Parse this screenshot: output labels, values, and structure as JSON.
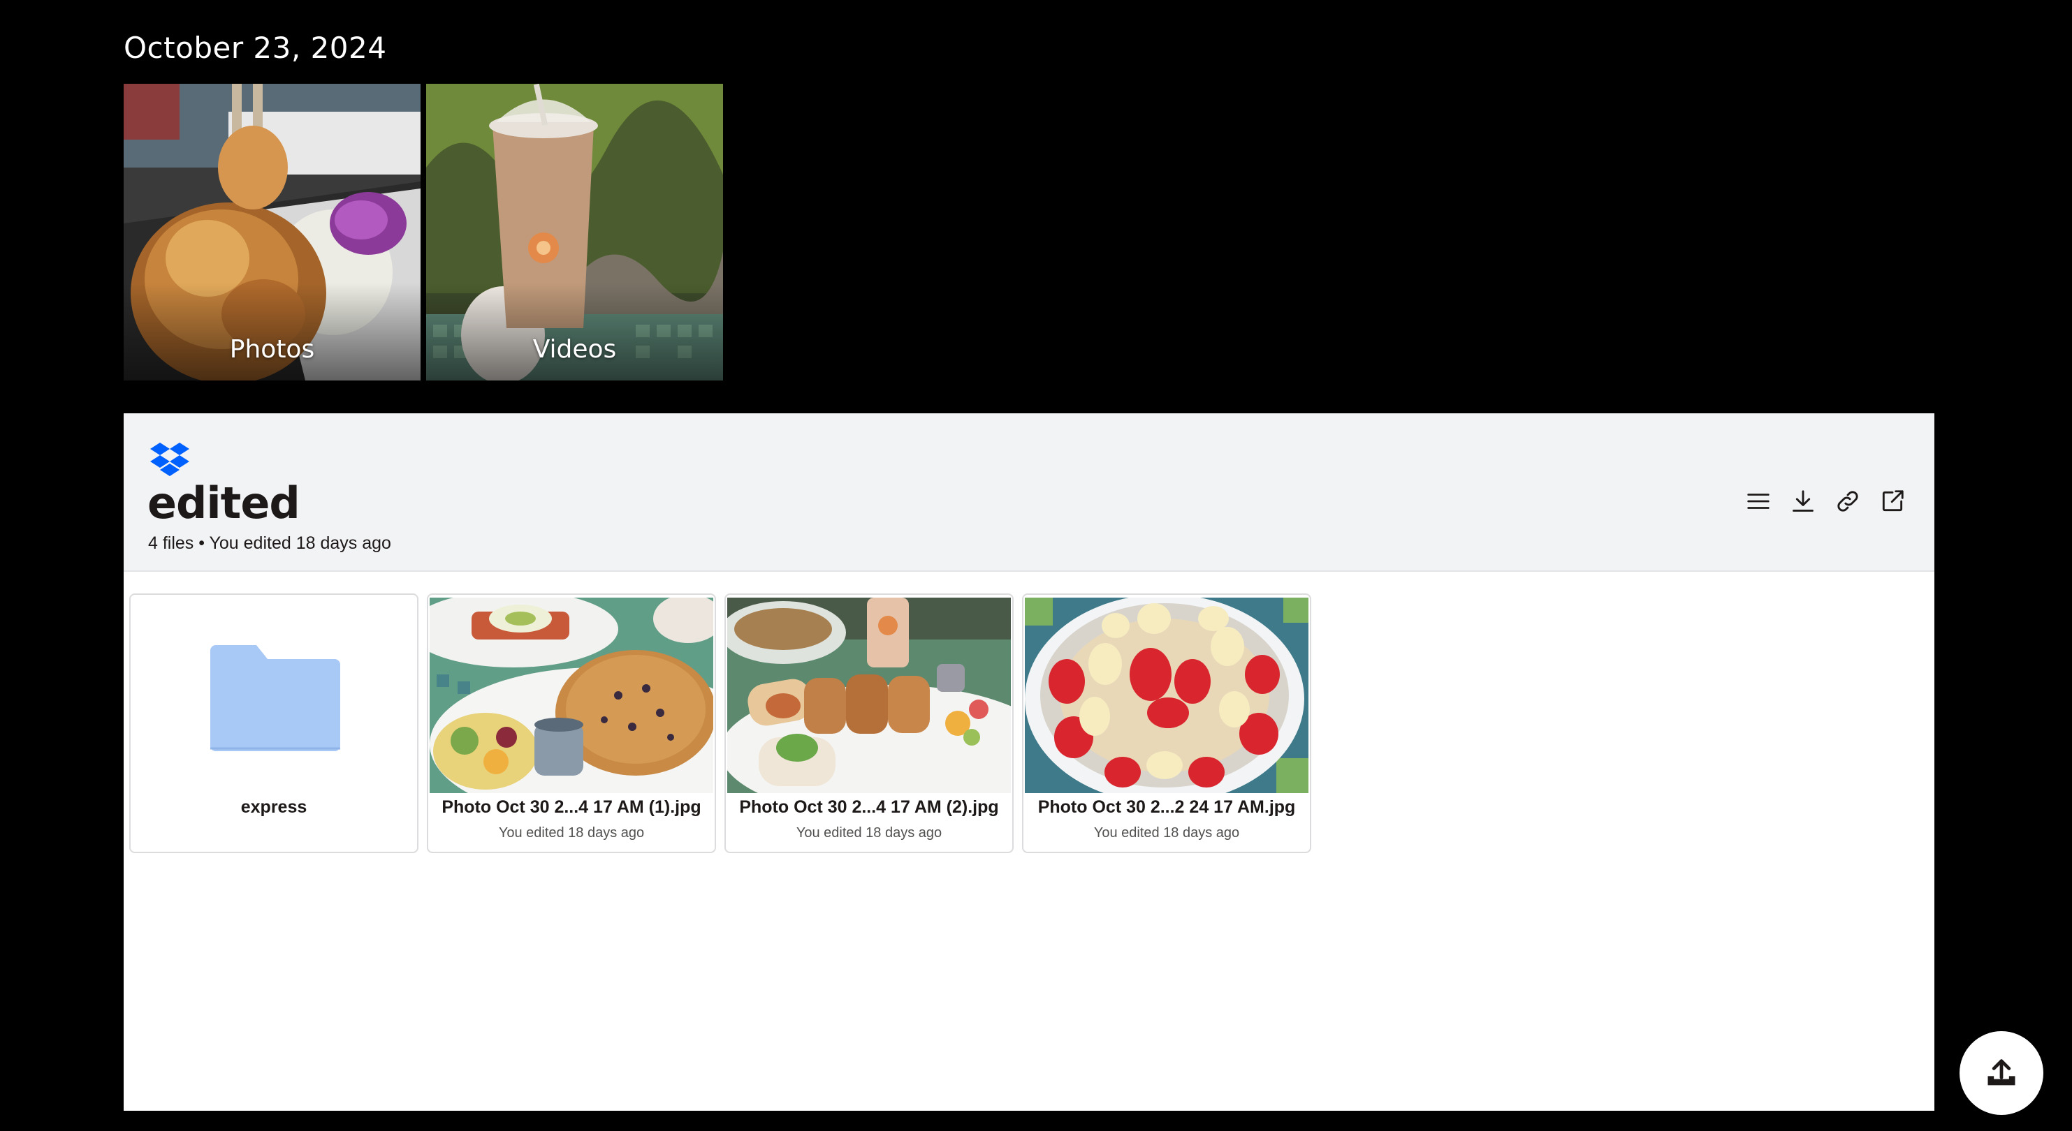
{
  "date_heading": "October 23, 2024",
  "albums": [
    {
      "label": "Photos"
    },
    {
      "label": "Videos"
    }
  ],
  "embed": {
    "brand_icon": "dropbox-logo-icon",
    "brand_color": "#0061fe",
    "folder_title": "edited",
    "folder_meta": "4 files • You edited 18 days ago",
    "actions": [
      {
        "icon": "list-view-icon"
      },
      {
        "icon": "download-icon"
      },
      {
        "icon": "link-icon"
      },
      {
        "icon": "open-external-icon"
      }
    ],
    "items": [
      {
        "type": "folder",
        "name": "express",
        "icon": "folder-icon",
        "folder_color": "#a8c8f5"
      },
      {
        "type": "image",
        "name": "Photo Oct 30 2...4 17 AM (1).jpg",
        "sub": "You edited 18 days ago"
      },
      {
        "type": "image",
        "name": "Photo Oct 30 2...4 17 AM (2).jpg",
        "sub": "You edited 18 days ago"
      },
      {
        "type": "image",
        "name": "Photo Oct 30 2...2 24 17 AM.jpg",
        "sub": "You edited 18 days ago"
      }
    ]
  },
  "upload_button": {
    "icon": "upload-icon"
  }
}
